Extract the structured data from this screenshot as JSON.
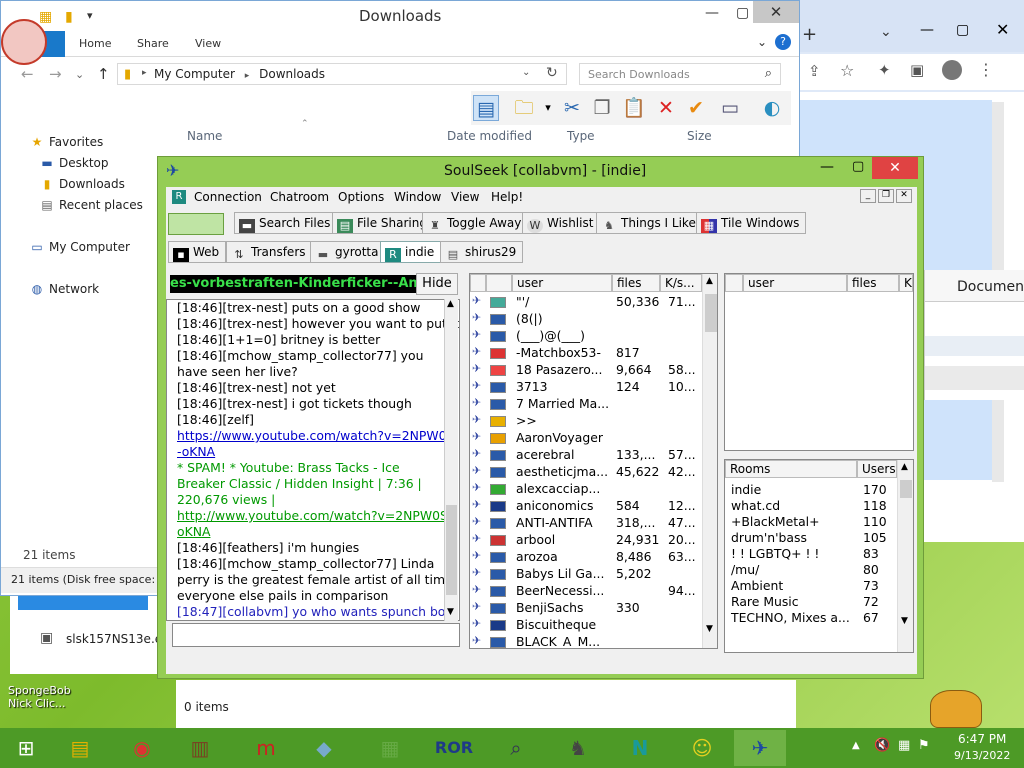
{
  "explorer": {
    "title": "Downloads",
    "tabs": [
      "File",
      "Home",
      "Share",
      "View"
    ],
    "address": [
      "My Computer",
      "Downloads"
    ],
    "address_sep": "▸",
    "search_placeholder": "Search Downloads",
    "columns": [
      "Name",
      "Date modified",
      "Type",
      "Size"
    ],
    "nav": {
      "favorites": "Favorites",
      "desktop": "Desktop",
      "downloads": "Downloads",
      "recent": "Recent places",
      "computer": "My Computer",
      "network": "Network"
    },
    "item_count": "21 items",
    "status": "21 items (Disk free space: 88",
    "file_name": "slsk157NS13e.e",
    "lower_count": "0 items"
  },
  "desktop": {
    "icon_label": "SpongeBob Nick Clic..."
  },
  "chrome": {
    "doc_label": "Document"
  },
  "soulseek": {
    "title": "SoulSeek [collabvm] - [indie]",
    "menu": [
      "Connection",
      "Chatroom",
      "Options",
      "Window",
      "View",
      "Help!"
    ],
    "toolbar": [
      "Search Files",
      "File Sharing",
      "Toggle Away",
      "Wishlist",
      "Things I Like",
      "Tile Windows"
    ],
    "tabs": [
      "Web",
      "Transfers",
      "gyrotta",
      "indie",
      "shirus29"
    ],
    "room_topic": "es-vorbestraften-Kinderficker--Antisem",
    "hide": "Hide",
    "chat": [
      "[18:46][trex-nest] puts on a good show",
      "[18:46][trex-nest] however you want to put it",
      "[18:46][1+1=0] britney is better",
      "[18:46][mchow_stamp_collector77] you",
      "have seen her live?",
      "[18:46][trex-nest] not yet",
      "[18:46][trex-nest] i got tickets though",
      "[18:46][zelf]",
      "https://www.youtube.com/watch?v=2NPW0S",
      "-oKNA",
      "* SPAM! * Youtube: Brass Tacks - Ice",
      "Breaker Classic / Hidden Insight | 7:36 |",
      "220,676 views |",
      "http://www.youtube.com/watch?v=2NPW0S-",
      "oKNA",
      "[18:46][feathers] i'm hungies",
      "[18:46][mchow_stamp_collector77] Linda",
      "perry is the greatest female artist of all time,",
      "everyone else pails in comparison",
      "[18:47][collabvm] yo who wants spunch bob"
    ],
    "user_cols": [
      "user",
      "files",
      "K/s..."
    ],
    "users": [
      {
        "n": "\"'/",
        "f": "50,336",
        "k": "71...",
        "c": "#4a9"
      },
      {
        "n": "(8(|)",
        "f": "",
        "k": "",
        "c": "#2a5aa8"
      },
      {
        "n": "(___)@(___)",
        "f": "",
        "k": "",
        "c": "#2a5aa8"
      },
      {
        "n": "-Matchbox53-",
        "f": "817",
        "k": "",
        "c": "#d33"
      },
      {
        "n": "18 Pasazero...",
        "f": "9,664",
        "k": "58...",
        "c": "#e44"
      },
      {
        "n": "3713",
        "f": "124",
        "k": "10...",
        "c": "#2a5aa8"
      },
      {
        "n": "7 Married Ma...",
        "f": "",
        "k": "",
        "c": "#2a5aa8"
      },
      {
        "n": ">>",
        "f": "",
        "k": "",
        "c": "#e8b000"
      },
      {
        "n": "AaronVoyager",
        "f": "",
        "k": "",
        "c": "#e8a000"
      },
      {
        "n": "acerebral",
        "f": "133,...",
        "k": "57...",
        "c": "#2a5aa8"
      },
      {
        "n": "aestheticjma...",
        "f": "45,622",
        "k": "42...",
        "c": "#2a5aa8"
      },
      {
        "n": "alexcacciap...",
        "f": "",
        "k": "",
        "c": "#3a3"
      },
      {
        "n": "aniconomics",
        "f": "584",
        "k": "12...",
        "c": "#1a3a88"
      },
      {
        "n": "ANTI-ANTIFA",
        "f": "318,...",
        "k": "47...",
        "c": "#2a5aa8"
      },
      {
        "n": "arbool",
        "f": "24,931",
        "k": "20...",
        "c": "#c33"
      },
      {
        "n": "arozoa",
        "f": "8,486",
        "k": "63...",
        "c": "#2a5aa8"
      },
      {
        "n": "Babys Lil Ga...",
        "f": "5,202",
        "k": "",
        "c": "#2a5aa8"
      },
      {
        "n": "BeerNecessi...",
        "f": "",
        "k": "94...",
        "c": "#2a5aa8"
      },
      {
        "n": "BenjiSachs",
        "f": "330",
        "k": "",
        "c": "#2a5aa8"
      },
      {
        "n": "Biscuitheque",
        "f": "",
        "k": "",
        "c": "#1a3a88"
      },
      {
        "n": "BLACK_A_M...",
        "f": "",
        "k": "",
        "c": "#2a5aa8"
      }
    ],
    "right_cols": [
      "user",
      "files",
      "K"
    ],
    "rooms_cols": [
      "Rooms",
      "Users"
    ],
    "rooms": [
      {
        "n": "indie",
        "u": "170"
      },
      {
        "n": "what.cd",
        "u": "118"
      },
      {
        "n": "+BlackMetal+",
        "u": "110"
      },
      {
        "n": "drum'n'bass",
        "u": "105"
      },
      {
        "n": "! ! LGBTQ+ ! !",
        "u": "83"
      },
      {
        "n": "/mu/",
        "u": "80"
      },
      {
        "n": "Ambient",
        "u": "73"
      },
      {
        "n": "Rare Music",
        "u": "72"
      },
      {
        "n": "TECHNO, Mixes a...",
        "u": "67"
      }
    ]
  },
  "taskbar": {
    "time": "6:47 PM",
    "date": "9/13/2022",
    "clock_icon": "clock-icon"
  }
}
